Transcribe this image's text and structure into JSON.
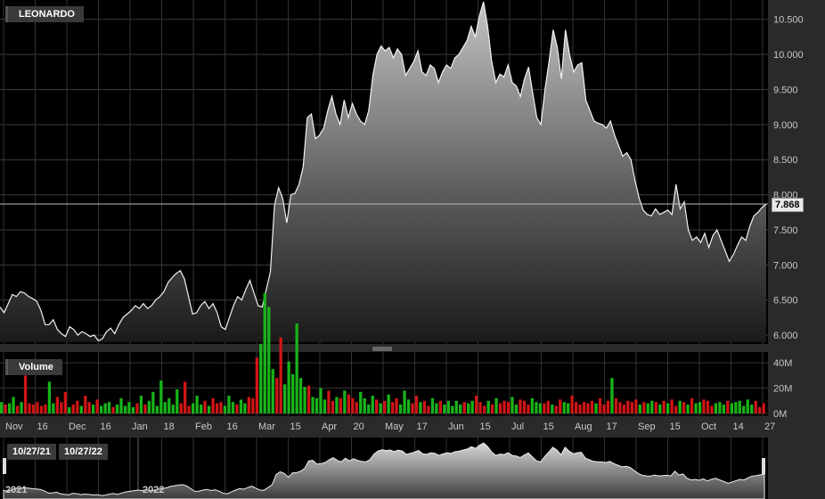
{
  "instrument": {
    "name": "LEONARDO",
    "last_price": "7.868",
    "last_value": 7.868
  },
  "volume_panel": {
    "title": "Volume",
    "ticks": [
      "40M",
      "20M",
      "0M"
    ]
  },
  "navigator": {
    "range_start": "10/27/21",
    "range_end": "10/27/22",
    "year_labels": [
      "2021",
      "2022"
    ]
  },
  "chart_data": {
    "type": "area",
    "title": "LEONARDO",
    "ylim": [
      5.9,
      10.75
    ],
    "yticks": [
      "6.000",
      "6.500",
      "7.000",
      "7.500",
      "8.000",
      "8.500",
      "9.000",
      "9.500",
      "10.000",
      "10.500"
    ],
    "xticks": [
      "Nov",
      "16",
      "Dec",
      "16",
      "Jan",
      "18",
      "Feb",
      "16",
      "Mar",
      "15",
      "Apr",
      "20",
      "May",
      "17",
      "Jun",
      "15",
      "Jul",
      "15",
      "Aug",
      "17",
      "Sep",
      "15",
      "Oct",
      "14",
      "27"
    ],
    "grid": true,
    "series": [
      {
        "values": [
          6.4,
          6.32,
          6.45,
          6.58,
          6.55,
          6.62,
          6.6,
          6.55,
          6.52,
          6.48,
          6.35,
          6.15,
          6.15,
          6.22,
          6.08,
          6.02,
          5.98,
          6.12,
          6.08,
          6.0,
          6.05,
          6.02,
          5.98,
          6.0,
          5.92,
          5.95,
          6.05,
          6.1,
          6.02,
          6.15,
          6.25,
          6.3,
          6.35,
          6.42,
          6.38,
          6.45,
          6.38,
          6.42,
          6.5,
          6.55,
          6.62,
          6.75,
          6.82,
          6.88,
          6.92,
          6.8,
          6.55,
          6.3,
          6.32,
          6.42,
          6.48,
          6.38,
          6.45,
          6.32,
          6.12,
          6.08,
          6.25,
          6.42,
          6.55,
          6.5,
          6.65,
          6.78,
          6.6,
          6.42,
          6.4,
          6.65,
          6.9,
          7.85,
          8.1,
          7.95,
          7.6,
          8.0,
          8.02,
          8.15,
          8.4,
          9.1,
          9.15,
          8.8,
          8.85,
          8.95,
          9.2,
          9.4,
          9.15,
          9.0,
          9.35,
          9.1,
          9.3,
          9.15,
          9.05,
          9.0,
          9.2,
          9.7,
          10.0,
          10.12,
          10.05,
          10.1,
          9.95,
          10.08,
          10.0,
          9.7,
          9.8,
          9.9,
          10.05,
          9.75,
          9.7,
          9.85,
          9.8,
          9.6,
          9.75,
          9.85,
          9.8,
          9.95,
          10.0,
          10.1,
          10.2,
          10.4,
          10.25,
          10.55,
          10.75,
          10.4,
          9.9,
          9.6,
          9.72,
          9.68,
          9.85,
          9.6,
          9.55,
          9.4,
          9.65,
          9.82,
          9.45,
          9.1,
          9.0,
          9.5,
          9.9,
          10.35,
          10.1,
          9.65,
          10.35,
          10.0,
          9.75,
          9.85,
          9.88,
          9.35,
          9.2,
          9.05,
          9.02,
          9.0,
          8.95,
          9.05,
          8.85,
          8.7,
          8.55,
          8.6,
          8.5,
          8.2,
          7.95,
          7.78,
          7.72,
          7.7,
          7.8,
          7.72,
          7.75,
          7.78,
          7.72,
          8.15,
          7.8,
          7.9,
          7.5,
          7.35,
          7.4,
          7.32,
          7.45,
          7.25,
          7.42,
          7.5,
          7.35,
          7.2,
          7.05,
          7.15,
          7.28,
          7.4,
          7.35,
          7.55,
          7.7,
          7.75,
          7.82,
          7.868
        ]
      },
      {
        "name": "Volume",
        "values": [
          9,
          7,
          8,
          13,
          6,
          9,
          30,
          8,
          7,
          9,
          6,
          7,
          25,
          8,
          13,
          9,
          17,
          5,
          7,
          10,
          6,
          14,
          9,
          7,
          11,
          6,
          8,
          9,
          5,
          7,
          12,
          6,
          9,
          5,
          8,
          14,
          7,
          10,
          17,
          6,
          26,
          9,
          12,
          7,
          19,
          8,
          25,
          6,
          8,
          14,
          7,
          10,
          6,
          12,
          8,
          9,
          6,
          14,
          9,
          7,
          11,
          8,
          13,
          12,
          44,
          55,
          95,
          84,
          35,
          28,
          60,
          23,
          41,
          31,
          71,
          28,
          21,
          22,
          13,
          12,
          20,
          11,
          18,
          10,
          13,
          12,
          18,
          15,
          12,
          9,
          17,
          12,
          7,
          14,
          11,
          8,
          10,
          15,
          9,
          12,
          7,
          18,
          11,
          8,
          14,
          9,
          10,
          6,
          12,
          8,
          10,
          7,
          10,
          6,
          10,
          7,
          9,
          8,
          10,
          14,
          9,
          6,
          10,
          7,
          12,
          8,
          10,
          9,
          13,
          7,
          11,
          10,
          7,
          12,
          9,
          8,
          8,
          10,
          7,
          6,
          11,
          9,
          8,
          14,
          9,
          7,
          9,
          8,
          10,
          8,
          12,
          7,
          10,
          28,
          12,
          9,
          7,
          10,
          9,
          11,
          7,
          9,
          8,
          10,
          9,
          7,
          10,
          8,
          11,
          6,
          10,
          9,
          7,
          12,
          8,
          9,
          11,
          10,
          6,
          8,
          9,
          7,
          10,
          8,
          9,
          10,
          6,
          11,
          7,
          10,
          5,
          8
        ]
      }
    ],
    "volume_ylim": [
      0,
      45
    ]
  }
}
